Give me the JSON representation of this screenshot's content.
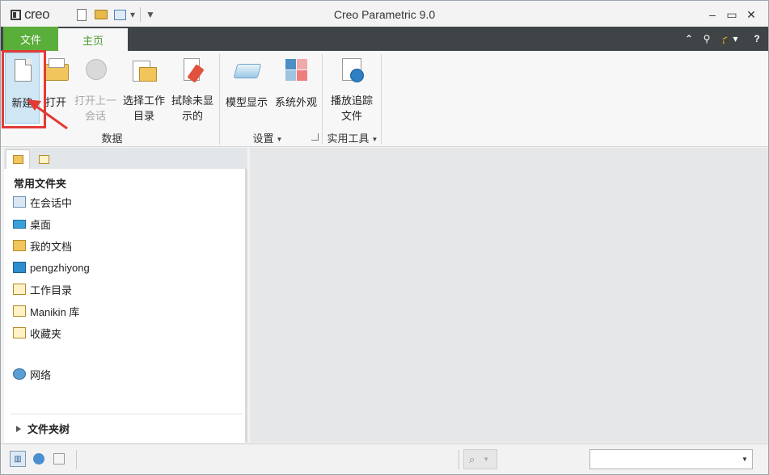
{
  "app": {
    "logo_text": "creo",
    "window_title": "Creo Parametric 9.0"
  },
  "tabs": {
    "file": "文件",
    "home": "主页"
  },
  "ribbon": {
    "data_group": {
      "label": "数据",
      "buttons": [
        {
          "label": "新建",
          "state": "active"
        },
        {
          "label": "打开",
          "state": "enabled"
        },
        {
          "label": "打开上一\n会话",
          "line1": "打开上一",
          "line2": "会话",
          "state": "disabled"
        },
        {
          "label": "选择工作\n目录",
          "line1": "选择工作",
          "line2": "目录",
          "state": "enabled"
        },
        {
          "label": "拭除未显\n示的",
          "line1": "拭除未显",
          "line2": "示的",
          "state": "enabled"
        }
      ]
    },
    "settings_group": {
      "label": "设置",
      "buttons": [
        {
          "label": "模型显示"
        },
        {
          "label": "系统外观"
        }
      ]
    },
    "utilities_group": {
      "label": "实用工具",
      "buttons": [
        {
          "line1": "播放追踪",
          "line2": "文件"
        }
      ]
    }
  },
  "navigator": {
    "section_title": "常用文件夹",
    "items": [
      {
        "label": "在会话中",
        "icon": "session-monitor-icon"
      },
      {
        "label": "桌面",
        "icon": "desktop-icon"
      },
      {
        "label": "我的文档",
        "icon": "my-documents-icon"
      },
      {
        "label": "pengzhiyong",
        "icon": "computer-icon"
      },
      {
        "label": "工作目录",
        "icon": "working-directory-icon"
      },
      {
        "label": "Manikin 库",
        "icon": "manikin-library-icon"
      },
      {
        "label": "收藏夹",
        "icon": "favorites-icon"
      }
    ],
    "network": {
      "label": "网络",
      "icon": "network-icon"
    },
    "folder_tree": "文件夹树"
  },
  "colors": {
    "file_tab": "#5aae3a",
    "tab_bar": "#3f4447",
    "highlight": "#e23b36",
    "main_area": "#e5e7e9"
  }
}
